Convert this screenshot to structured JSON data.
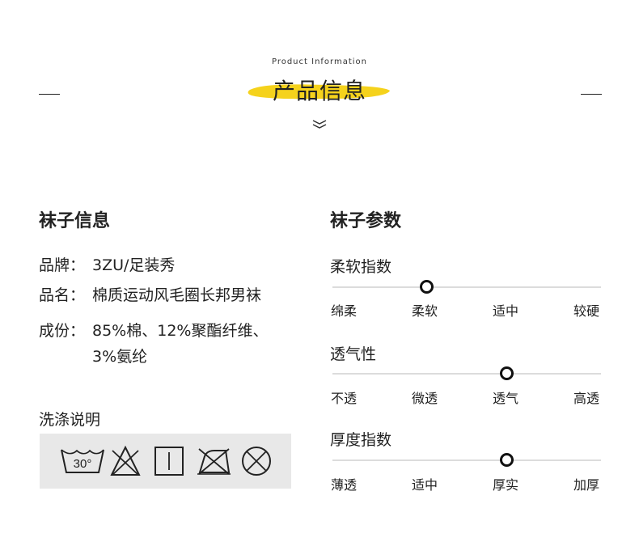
{
  "header": {
    "subtitle": "Product Information",
    "title": "产品信息",
    "accent_color": "#f5d21c"
  },
  "left": {
    "title": "袜子信息",
    "rows": [
      {
        "key": "品牌：",
        "value": "3ZU/足装秀"
      },
      {
        "key": "品名：",
        "value": "棉质运动风毛圈长邦男袜"
      },
      {
        "key": "成份：",
        "value": "85%棉、12%聚酯纤维、",
        "value2": "3%氨纶"
      }
    ],
    "wash_title": "洗涤说明",
    "wash_icons": [
      {
        "name": "wash-30-icon",
        "text": "30°"
      },
      {
        "name": "no-bleach-icon"
      },
      {
        "name": "line-dry-icon"
      },
      {
        "name": "no-iron-icon"
      },
      {
        "name": "no-dry-clean-icon"
      }
    ]
  },
  "right": {
    "title": "袜子参数",
    "params": [
      {
        "label": "柔软指数",
        "ticks": [
          "绵柔",
          "柔软",
          "适中",
          "较硬"
        ],
        "level": 0.35
      },
      {
        "label": "透气性",
        "ticks": [
          "不透",
          "微透",
          "透气",
          "高透"
        ],
        "level": 0.65
      },
      {
        "label": "厚度指数",
        "ticks": [
          "薄透",
          "适中",
          "厚实",
          "加厚"
        ],
        "level": 0.65
      }
    ]
  }
}
